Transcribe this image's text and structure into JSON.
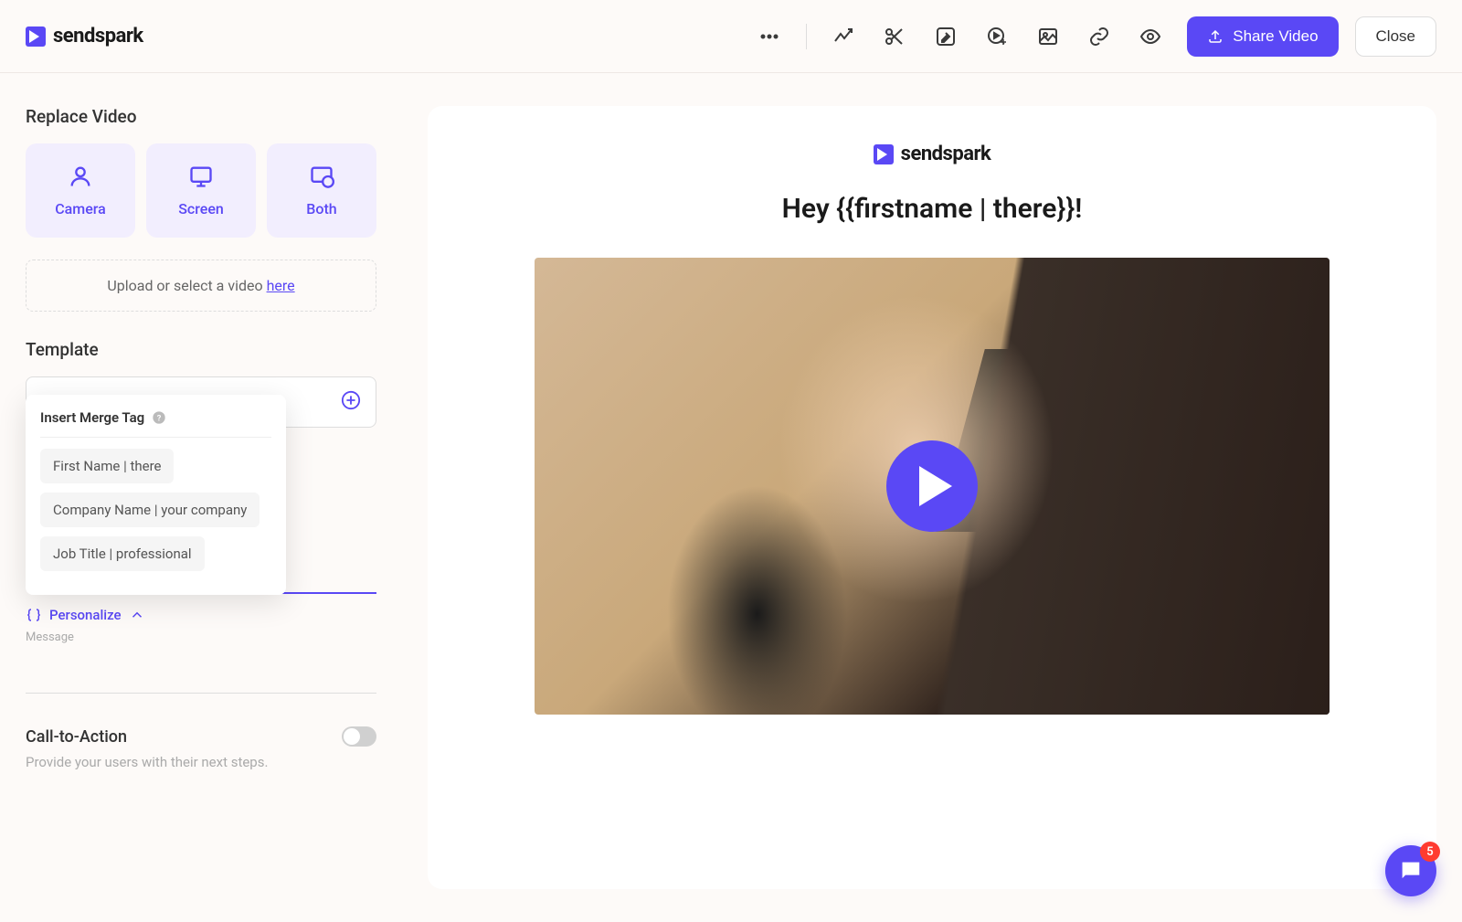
{
  "brand": "sendspark",
  "topbar": {
    "share_label": "Share Video",
    "close_label": "Close"
  },
  "sidebar": {
    "replace_video_title": "Replace Video",
    "options": {
      "camera": "Camera",
      "screen": "Screen",
      "both": "Both"
    },
    "upload_text": "Upload or select a video ",
    "upload_link": "here",
    "template_title": "Template",
    "personalize_label": "Personalize",
    "message_label": "Message",
    "cta_label": "Call-to-Action",
    "cta_desc": "Provide your users with their next steps."
  },
  "merge_popup": {
    "title": "Insert Merge Tag",
    "tags": [
      "First Name | there",
      "Company Name | your company",
      "Job Title | professional"
    ]
  },
  "preview": {
    "title": "Hey {{firstname | there}}!"
  },
  "chat_badge": "5"
}
